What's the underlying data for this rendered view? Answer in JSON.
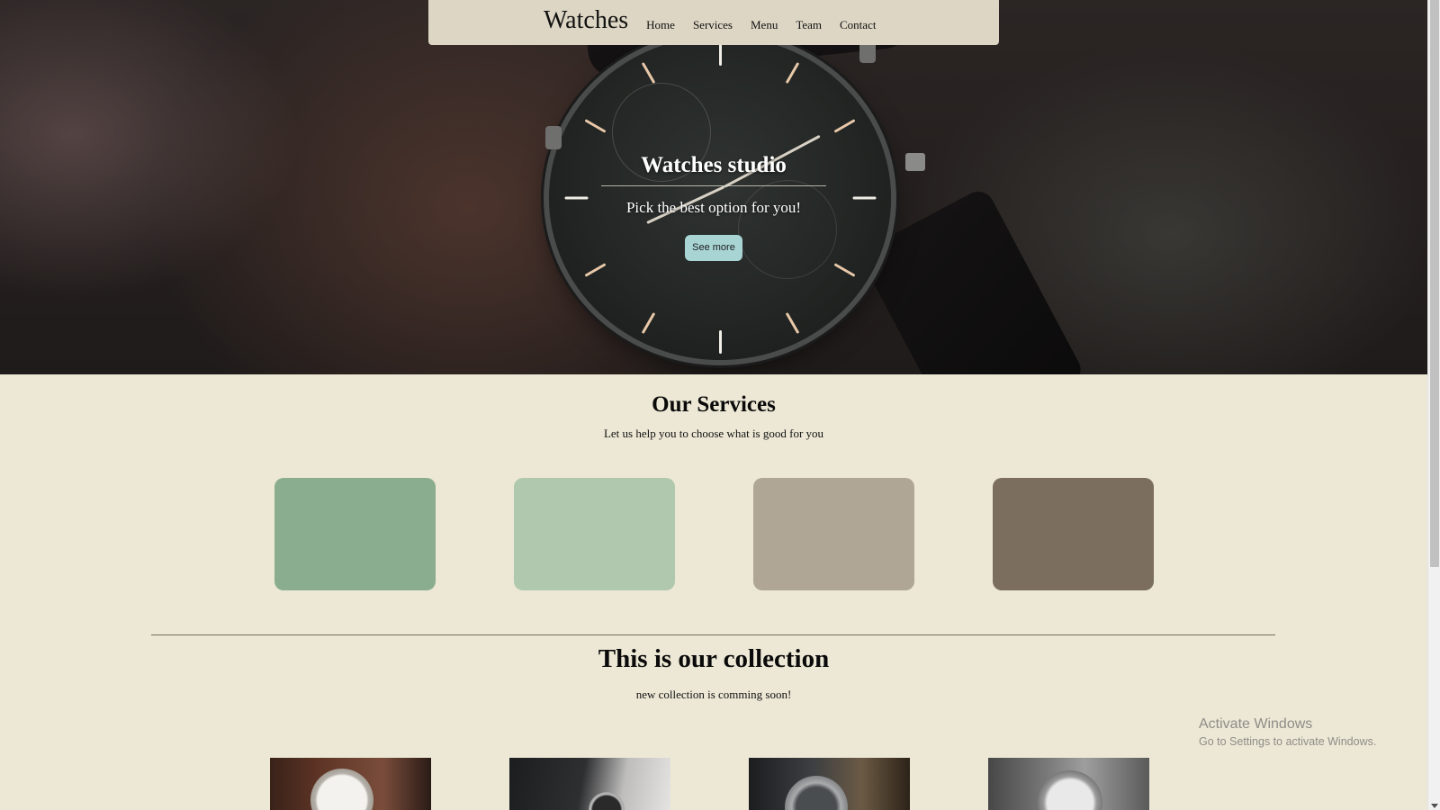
{
  "nav": {
    "brand": "Watches",
    "links": [
      "Home",
      "Services",
      "Menu",
      "Team",
      "Contact"
    ]
  },
  "hero": {
    "title": "Watches studio",
    "subtitle": "Pick the best option for you!",
    "cta_label": "See more"
  },
  "services": {
    "title": "Our Services",
    "subtitle": "Let us help you to choose what is good for you",
    "cards": [
      {
        "color": "#8aad8f"
      },
      {
        "color": "#b0c9ae"
      },
      {
        "color": "#b0a695"
      },
      {
        "color": "#7b6e5f"
      }
    ]
  },
  "collection": {
    "title": "This is our collection",
    "subtitle": "new collection is comming soon!",
    "photos": [
      "watch-brown-strap",
      "watch-black-sleeve",
      "watch-steel-bracelet",
      "watch-chronograph-gray"
    ]
  },
  "watermark": {
    "title": "Activate Windows",
    "subtitle": "Go to Settings to activate Windows."
  },
  "colors": {
    "page_bg": "#ede8d5",
    "nav_bg": "#ddd6c4",
    "cta_bg": "#a8d4d4"
  }
}
